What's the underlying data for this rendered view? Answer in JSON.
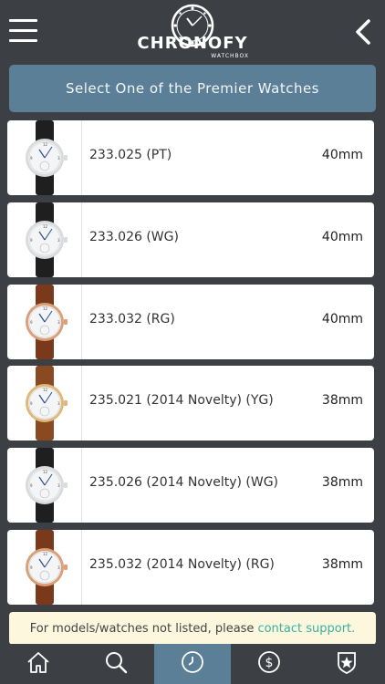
{
  "header": {
    "logo_text": "CHRONOFY",
    "logo_subtext": "WATCHBOX",
    "menu_icon": "hamburger-menu-icon",
    "back_icon": "chevron-left-icon"
  },
  "banner": {
    "label": "Select One of the Premier Watches",
    "color": "#5b7f96"
  },
  "watches": [
    {
      "model": "233.025 (PT)",
      "size": "40mm",
      "case_color": "#d9dbde",
      "strap_color": "#1f1f1f"
    },
    {
      "model": "233.026 (WG)",
      "size": "40mm",
      "case_color": "#d9dbde",
      "strap_color": "#1f1f1f"
    },
    {
      "model": "233.032 (RG)",
      "size": "40mm",
      "case_color": "#d9a07a",
      "strap_color": "#7a3a1c"
    },
    {
      "model": "235.021 (2014 Novelty) (YG)",
      "size": "38mm",
      "case_color": "#e0b77a",
      "strap_color": "#8a4a22"
    },
    {
      "model": "235.026 (2014 Novelty) (WG)",
      "size": "38mm",
      "case_color": "#d9dbde",
      "strap_color": "#1f1f1f"
    },
    {
      "model": "235.032 (2014 Novelty) (RG)",
      "size": "38mm",
      "case_color": "#d9a07a",
      "strap_color": "#7a3a1c"
    }
  ],
  "notice": {
    "text": "For models/watches not listed, please",
    "link": "contact support."
  },
  "tabbar": {
    "tabs": [
      {
        "icon": "home-icon",
        "active": false
      },
      {
        "icon": "search-icon",
        "active": false
      },
      {
        "icon": "clock-icon",
        "active": true
      },
      {
        "icon": "dollar-icon",
        "active": false
      },
      {
        "icon": "star-badge-icon",
        "active": false
      }
    ]
  }
}
